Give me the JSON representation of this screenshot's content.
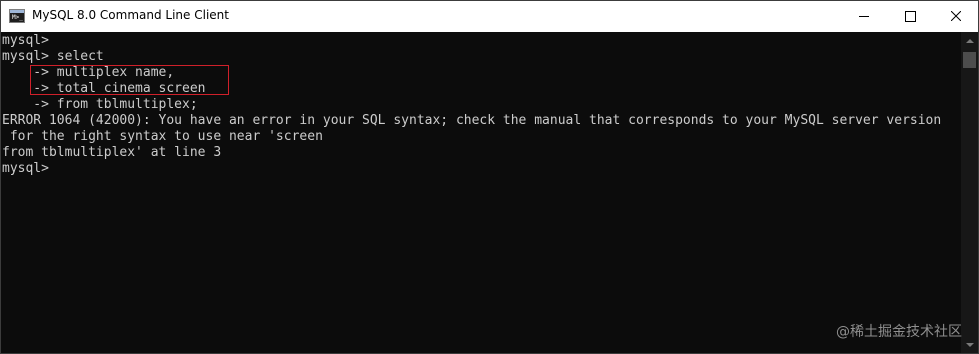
{
  "window": {
    "title": "MySQL 8.0 Command Line Client",
    "icon": "console-app-icon",
    "icon_glyph": "M>_"
  },
  "console": {
    "lines": [
      "mysql>",
      "mysql> select",
      "    -> multiplex name,",
      "    -> total cinema screen",
      "    -> from tblmultiplex;",
      "ERROR 1064 (42000): You have an error in your SQL syntax; check the manual that corresponds to your MySQL server version",
      " for the right syntax to use near 'screen",
      "from tblmultiplex' at line 3",
      "mysql>"
    ],
    "highlight_color": "#d0202a"
  },
  "watermark": "@稀土掘金技术社区",
  "colors": {
    "background": "#0c0c0c",
    "text": "#cccccc",
    "titlebar": "#ffffff"
  }
}
